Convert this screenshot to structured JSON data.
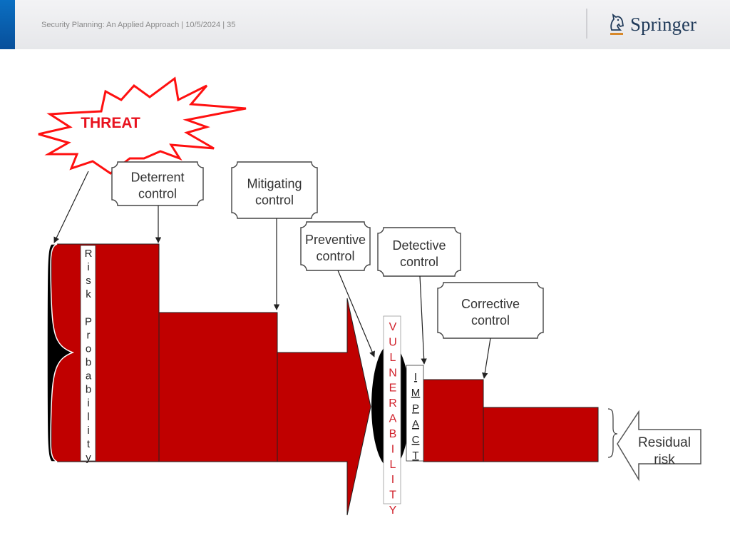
{
  "header": {
    "footer_text": "Security Planning: An Applied Approach | 10/5/2024 | 35",
    "logo_text": "Springer",
    "logo_icon": "horse-head-icon",
    "accent_color": "#0a6fc2"
  },
  "diagram": {
    "threat_label": "THREAT",
    "controls": {
      "deterrent": [
        "Deterrent",
        "control"
      ],
      "mitigating": [
        "Mitigating",
        "control"
      ],
      "preventive": [
        "Preventive",
        "control"
      ],
      "detective": [
        "Detective",
        "control"
      ],
      "corrective": [
        "Corrective",
        "control"
      ]
    },
    "risk_probability_letters": [
      "R",
      "i",
      "s",
      "k",
      "",
      "P",
      "r",
      "o",
      "b",
      "a",
      "b",
      "i",
      "l",
      "i",
      "t",
      "y"
    ],
    "vulnerability_letters": [
      "V",
      "U",
      "L",
      "N",
      "E",
      "R",
      "A",
      "B",
      "I",
      "L",
      "I",
      "T",
      "Y"
    ],
    "impact_letters": [
      "I",
      "M",
      "P",
      "A",
      "C",
      "T"
    ],
    "residual_risk": [
      "Residual",
      "risk"
    ],
    "colors": {
      "risk_fill": "#c00000",
      "threat_stroke": "#ff0000",
      "vulnerability_text": "#d0202a"
    }
  }
}
